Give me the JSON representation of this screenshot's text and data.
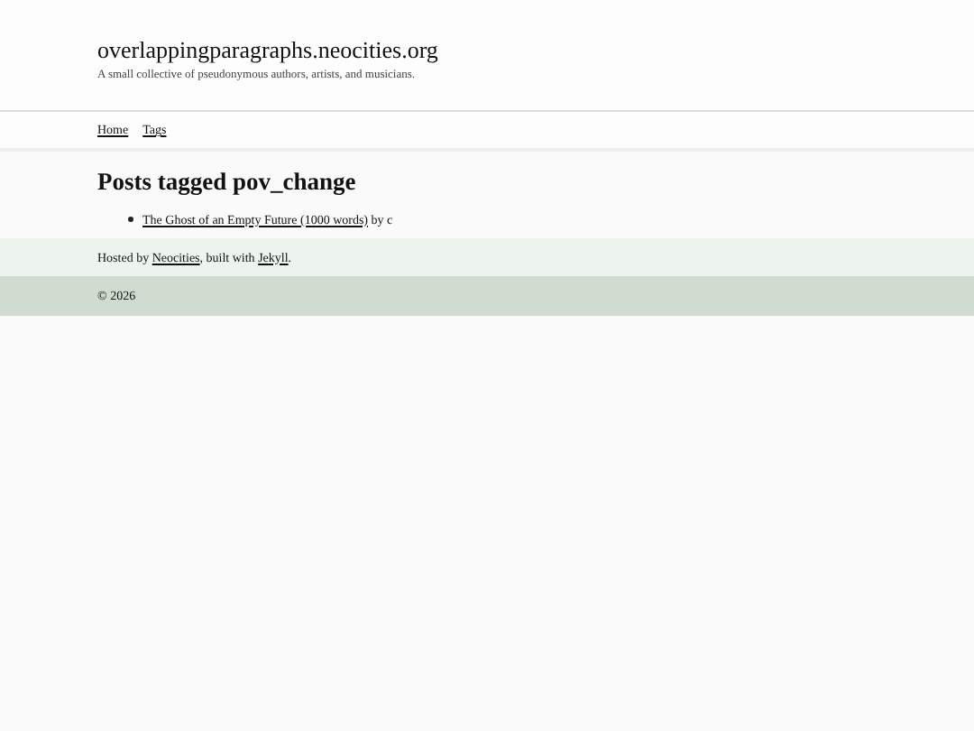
{
  "site": {
    "title": "overlappingparagraphs.neocities.org",
    "tagline": "A small collective of pseudonymous authors, artists, and musicians."
  },
  "nav": [
    "Home",
    "Tags"
  ],
  "heading": "Posts tagged pov_change",
  "posts": [
    {
      "title": "The Ghost of an Empty Future (1000 words)",
      "byline": "by c"
    }
  ],
  "footer": {
    "parts": [
      {
        "kind": "text",
        "text": "Hosted by "
      },
      {
        "kind": "link",
        "text": "Neocities"
      },
      {
        "kind": "text",
        "text": ", built with "
      },
      {
        "kind": "link",
        "text": "Jekyll"
      },
      {
        "kind": "text",
        "text": "."
      }
    ],
    "copyright": "© 2026"
  }
}
